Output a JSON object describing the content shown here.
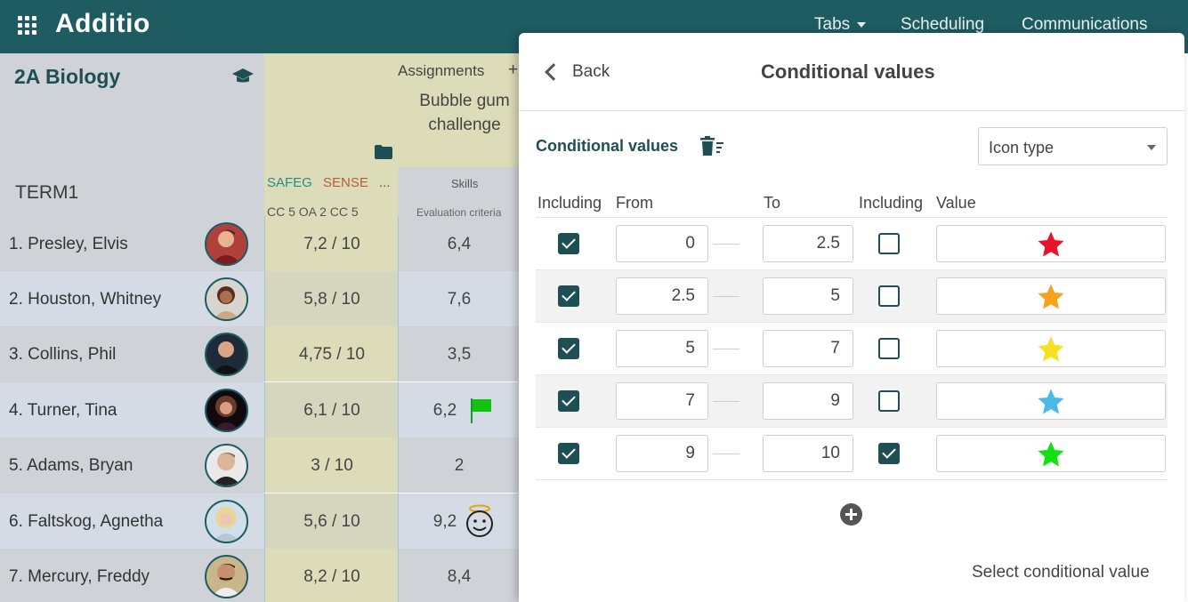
{
  "app": {
    "title": "Additio"
  },
  "nav": {
    "tabs": "Tabs",
    "scheduling": "Scheduling",
    "communications": "Communications"
  },
  "gradebook": {
    "class_name": "2A Biology",
    "term": "TERM1",
    "assignments_label": "Assignments",
    "add_symbol": "+",
    "assignment_name": "Bubble gum challenge",
    "competencies": [
      "SAFEG",
      "SENSE",
      "..."
    ],
    "criteria_codes": "CC 5 OA 2   CC 5",
    "skills_label": "Skills",
    "evaluation_label": "Evaluation criteria",
    "students": [
      {
        "name": "1. Presley, Elvis",
        "grade": "7,2 / 10",
        "skill": "6,4"
      },
      {
        "name": "2. Houston, Whitney",
        "grade": "5,8 / 10",
        "skill": "7,6"
      },
      {
        "name": "3. Collins, Phil",
        "grade": "4,75 / 10",
        "skill": "3,5"
      },
      {
        "name": "4. Turner, Tina",
        "grade": "6,1 / 10",
        "skill": "6,2"
      },
      {
        "name": "5. Adams, Bryan",
        "grade": "3 / 10",
        "skill": "2"
      },
      {
        "name": "6. Faltskog, Agnetha",
        "grade": "5,6 / 10",
        "skill": "9,2"
      },
      {
        "name": "7. Mercury, Freddy",
        "grade": "8,2 / 10",
        "skill": "8,4"
      }
    ]
  },
  "modal": {
    "back_label": "Back",
    "title": "Conditional values",
    "section_title": "Conditional values",
    "type_select": "Icon type",
    "columns": {
      "including_from": "Including",
      "from": "From",
      "to": "To",
      "including_to": "Including",
      "value": "Value"
    },
    "rows": [
      {
        "include_from": true,
        "from": "0",
        "to": "2.5",
        "include_to": false,
        "icon": "star-icon",
        "color": "#e8132a"
      },
      {
        "include_from": true,
        "from": "2.5",
        "to": "5",
        "include_to": false,
        "icon": "star-icon",
        "color": "#f5a21c"
      },
      {
        "include_from": true,
        "from": "5",
        "to": "7",
        "include_to": false,
        "icon": "star-icon",
        "color": "#f5e11f"
      },
      {
        "include_from": true,
        "from": "7",
        "to": "9",
        "include_to": false,
        "icon": "star-icon",
        "color": "#4db8ea"
      },
      {
        "include_from": true,
        "from": "9",
        "to": "10",
        "include_to": true,
        "icon": "star-icon",
        "color": "#12e012"
      }
    ],
    "select_conditional_value": "Select conditional value"
  },
  "colors": {
    "brand": "#1e5c62",
    "accent_dark": "#1e4f55",
    "grade_bg": "#dcdcb8",
    "names_bg": "#cfd3d7"
  }
}
